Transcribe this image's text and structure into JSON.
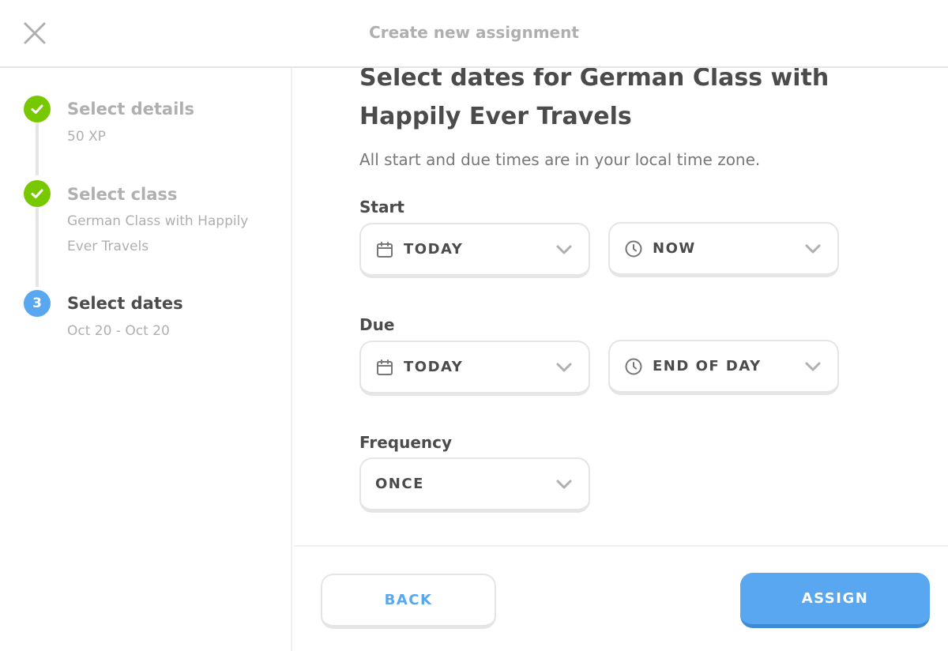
{
  "header": {
    "title": "Create new assignment"
  },
  "steps": [
    {
      "title": "Select details",
      "subtitle": "50 XP",
      "status": "done"
    },
    {
      "title": "Select class",
      "subtitle": "German Class with Happily Ever Travels",
      "status": "done"
    },
    {
      "title": "Select dates",
      "subtitle": "Oct 20 - Oct 20",
      "status": "current",
      "number": "3"
    }
  ],
  "main": {
    "title": "Select dates for German Class with Happily Ever Travels",
    "description": "All start and due times are in your local time zone.",
    "start": {
      "label": "Start",
      "date": "TODAY",
      "time": "NOW"
    },
    "due": {
      "label": "Due",
      "date": "TODAY",
      "time": "END OF DAY"
    },
    "frequency": {
      "label": "Frequency",
      "value": "ONCE"
    }
  },
  "footer": {
    "back_label": "BACK",
    "assign_label": "ASSIGN"
  },
  "colors": {
    "accent": "#58a7f0",
    "success": "#78c800",
    "border": "#e5e5e5",
    "muted": "#afafaf",
    "text": "#4b4b4b"
  },
  "icons": {
    "close": "close-icon",
    "check": "check-icon",
    "calendar": "calendar-icon",
    "clock": "clock-icon",
    "chevron": "chevron-down-icon"
  }
}
